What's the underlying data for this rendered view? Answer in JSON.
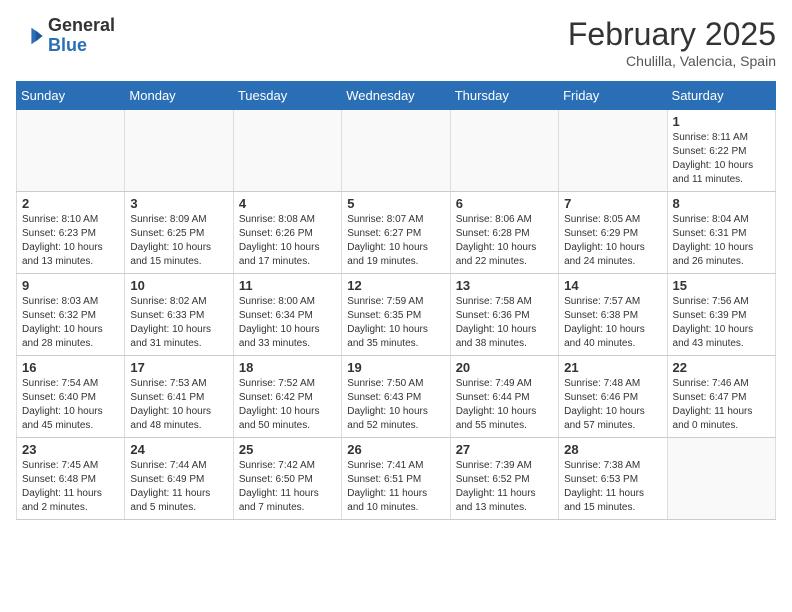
{
  "header": {
    "logo_general": "General",
    "logo_blue": "Blue",
    "month_title": "February 2025",
    "location": "Chulilla, Valencia, Spain"
  },
  "weekdays": [
    "Sunday",
    "Monday",
    "Tuesday",
    "Wednesday",
    "Thursday",
    "Friday",
    "Saturday"
  ],
  "weeks": [
    [
      {
        "day": "",
        "info": ""
      },
      {
        "day": "",
        "info": ""
      },
      {
        "day": "",
        "info": ""
      },
      {
        "day": "",
        "info": ""
      },
      {
        "day": "",
        "info": ""
      },
      {
        "day": "",
        "info": ""
      },
      {
        "day": "1",
        "info": "Sunrise: 8:11 AM\nSunset: 6:22 PM\nDaylight: 10 hours\nand 11 minutes."
      }
    ],
    [
      {
        "day": "2",
        "info": "Sunrise: 8:10 AM\nSunset: 6:23 PM\nDaylight: 10 hours\nand 13 minutes."
      },
      {
        "day": "3",
        "info": "Sunrise: 8:09 AM\nSunset: 6:25 PM\nDaylight: 10 hours\nand 15 minutes."
      },
      {
        "day": "4",
        "info": "Sunrise: 8:08 AM\nSunset: 6:26 PM\nDaylight: 10 hours\nand 17 minutes."
      },
      {
        "day": "5",
        "info": "Sunrise: 8:07 AM\nSunset: 6:27 PM\nDaylight: 10 hours\nand 19 minutes."
      },
      {
        "day": "6",
        "info": "Sunrise: 8:06 AM\nSunset: 6:28 PM\nDaylight: 10 hours\nand 22 minutes."
      },
      {
        "day": "7",
        "info": "Sunrise: 8:05 AM\nSunset: 6:29 PM\nDaylight: 10 hours\nand 24 minutes."
      },
      {
        "day": "8",
        "info": "Sunrise: 8:04 AM\nSunset: 6:31 PM\nDaylight: 10 hours\nand 26 minutes."
      }
    ],
    [
      {
        "day": "9",
        "info": "Sunrise: 8:03 AM\nSunset: 6:32 PM\nDaylight: 10 hours\nand 28 minutes."
      },
      {
        "day": "10",
        "info": "Sunrise: 8:02 AM\nSunset: 6:33 PM\nDaylight: 10 hours\nand 31 minutes."
      },
      {
        "day": "11",
        "info": "Sunrise: 8:00 AM\nSunset: 6:34 PM\nDaylight: 10 hours\nand 33 minutes."
      },
      {
        "day": "12",
        "info": "Sunrise: 7:59 AM\nSunset: 6:35 PM\nDaylight: 10 hours\nand 35 minutes."
      },
      {
        "day": "13",
        "info": "Sunrise: 7:58 AM\nSunset: 6:36 PM\nDaylight: 10 hours\nand 38 minutes."
      },
      {
        "day": "14",
        "info": "Sunrise: 7:57 AM\nSunset: 6:38 PM\nDaylight: 10 hours\nand 40 minutes."
      },
      {
        "day": "15",
        "info": "Sunrise: 7:56 AM\nSunset: 6:39 PM\nDaylight: 10 hours\nand 43 minutes."
      }
    ],
    [
      {
        "day": "16",
        "info": "Sunrise: 7:54 AM\nSunset: 6:40 PM\nDaylight: 10 hours\nand 45 minutes."
      },
      {
        "day": "17",
        "info": "Sunrise: 7:53 AM\nSunset: 6:41 PM\nDaylight: 10 hours\nand 48 minutes."
      },
      {
        "day": "18",
        "info": "Sunrise: 7:52 AM\nSunset: 6:42 PM\nDaylight: 10 hours\nand 50 minutes."
      },
      {
        "day": "19",
        "info": "Sunrise: 7:50 AM\nSunset: 6:43 PM\nDaylight: 10 hours\nand 52 minutes."
      },
      {
        "day": "20",
        "info": "Sunrise: 7:49 AM\nSunset: 6:44 PM\nDaylight: 10 hours\nand 55 minutes."
      },
      {
        "day": "21",
        "info": "Sunrise: 7:48 AM\nSunset: 6:46 PM\nDaylight: 10 hours\nand 57 minutes."
      },
      {
        "day": "22",
        "info": "Sunrise: 7:46 AM\nSunset: 6:47 PM\nDaylight: 11 hours\nand 0 minutes."
      }
    ],
    [
      {
        "day": "23",
        "info": "Sunrise: 7:45 AM\nSunset: 6:48 PM\nDaylight: 11 hours\nand 2 minutes."
      },
      {
        "day": "24",
        "info": "Sunrise: 7:44 AM\nSunset: 6:49 PM\nDaylight: 11 hours\nand 5 minutes."
      },
      {
        "day": "25",
        "info": "Sunrise: 7:42 AM\nSunset: 6:50 PM\nDaylight: 11 hours\nand 7 minutes."
      },
      {
        "day": "26",
        "info": "Sunrise: 7:41 AM\nSunset: 6:51 PM\nDaylight: 11 hours\nand 10 minutes."
      },
      {
        "day": "27",
        "info": "Sunrise: 7:39 AM\nSunset: 6:52 PM\nDaylight: 11 hours\nand 13 minutes."
      },
      {
        "day": "28",
        "info": "Sunrise: 7:38 AM\nSunset: 6:53 PM\nDaylight: 11 hours\nand 15 minutes."
      },
      {
        "day": "",
        "info": ""
      }
    ]
  ]
}
